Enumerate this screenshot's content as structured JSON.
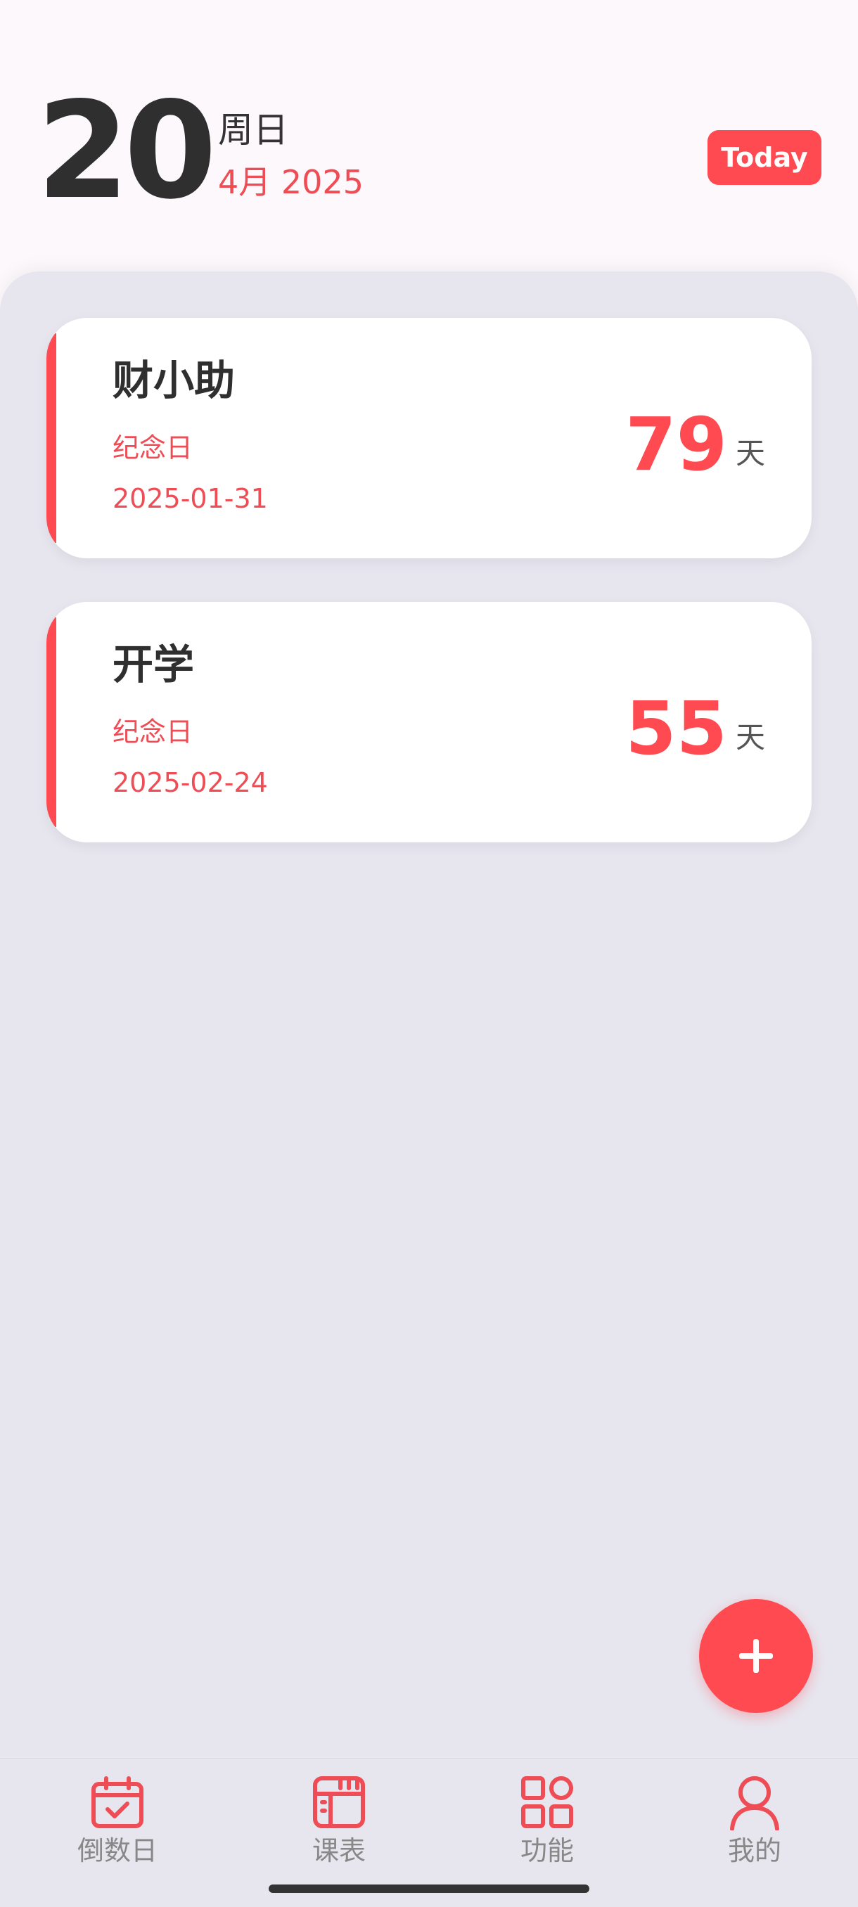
{
  "header": {
    "day": "20",
    "weekday": "周日",
    "month_year": "4月 2025",
    "today_button": "Today"
  },
  "cards": [
    {
      "title": "财小助",
      "type": "纪念日",
      "date": "2025-01-31",
      "days": "79",
      "unit": "天"
    },
    {
      "title": "开学",
      "type": "纪念日",
      "date": "2025-02-24",
      "days": "55",
      "unit": "天"
    }
  ],
  "fab": {
    "icon": "plus-icon"
  },
  "tabbar": {
    "items": [
      {
        "label": "倒数日",
        "icon": "calendar-check-icon"
      },
      {
        "label": "课表",
        "icon": "schedule-icon"
      },
      {
        "label": "功能",
        "icon": "grid-icon"
      },
      {
        "label": "我的",
        "icon": "user-icon"
      }
    ]
  },
  "colors": {
    "accent": "#ff4a52",
    "background": "#e7e6ef",
    "header_background": "#fdf8fb"
  }
}
